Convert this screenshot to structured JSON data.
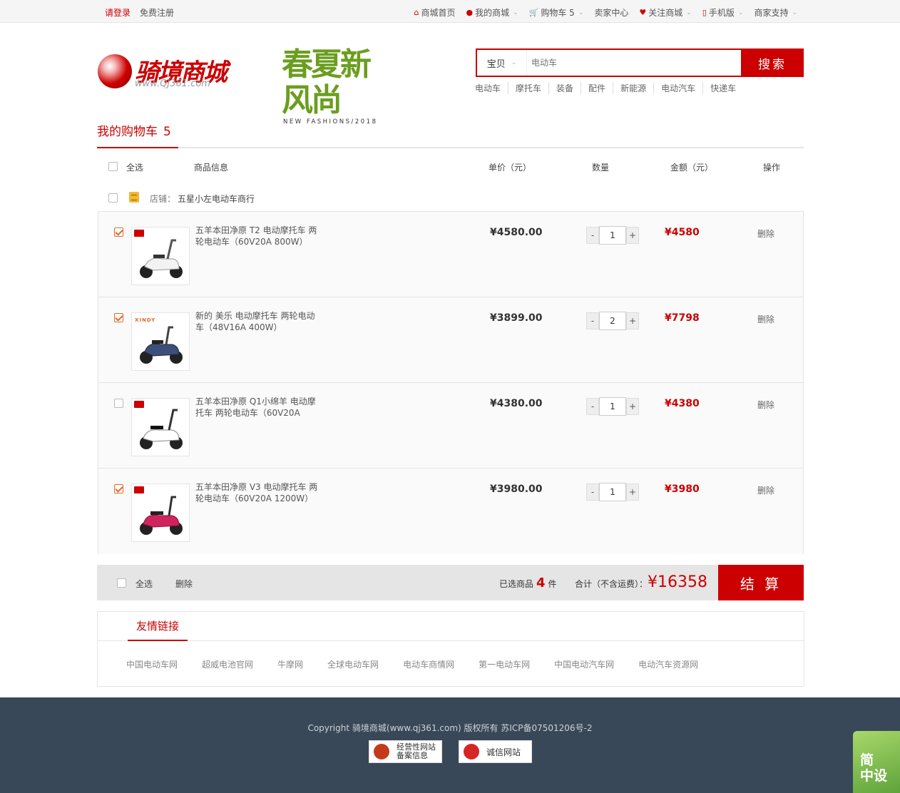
{
  "topbar": {
    "login": "请登录",
    "register": "免费注册",
    "home": "商城首页",
    "my_mall": "我的商城",
    "cart": "购物车 5",
    "seller": "卖家中心",
    "follow": "关注商城",
    "mobile": "手机版",
    "support": "商家支持"
  },
  "logo": {
    "text": "骑境商城",
    "url": "www.QJ361.com"
  },
  "banner": {
    "cn": "春夏新风尚",
    "en": "NEW FASHIONS/2018"
  },
  "search": {
    "category": "宝贝",
    "placeholder": "电动车",
    "button": "搜索",
    "hotwords": [
      "电动车",
      "摩托车",
      "装备",
      "配件",
      "新能源",
      "电动汽车",
      "快递车"
    ]
  },
  "cart": {
    "title": "我的购物车",
    "count": "5",
    "headers": {
      "select_all": "全选",
      "info": "商品信息",
      "price": "单价（元）",
      "qty": "数量",
      "amount": "金额（元）",
      "op": "操作"
    },
    "shop_label": "店铺：",
    "shop_name": "五星小左电动车商行",
    "items": [
      {
        "name": "五羊本田净原 T2 电动摩托车 两轮电动车（60V20A 800W）",
        "price": "¥4580.00",
        "qty": "1",
        "amount": "¥4580",
        "delete": "删除",
        "checked": true
      },
      {
        "name": "新的 美乐 电动摩托车 两轮电动车（48V16A 400W）",
        "price": "¥3899.00",
        "qty": "2",
        "amount": "¥7798",
        "delete": "删除",
        "checked": true
      },
      {
        "name": "五羊本田净原 Q1小绵羊 电动摩托车 两轮电动车（60V20A",
        "price": "¥4380.00",
        "qty": "1",
        "amount": "¥4380",
        "delete": "删除",
        "checked": false
      },
      {
        "name": "五羊本田净原 V3 电动摩托车 两轮电动车（60V20A 1200W）",
        "price": "¥3980.00",
        "qty": "1",
        "amount": "¥3980",
        "delete": "删除",
        "checked": true
      }
    ],
    "qty_minus": "-",
    "qty_plus": "+",
    "xindy_badge": "XINDY"
  },
  "summary": {
    "select_all": "全选",
    "delete": "删除",
    "selected_prefix": "已选商品",
    "selected_count": "4",
    "selected_suffix": "件",
    "total_label": "合计（不含运费）：",
    "total": "¥16358",
    "checkout": "结 算"
  },
  "links": {
    "title": "友情链接",
    "items": [
      "中国电动车网",
      "超威电池官网",
      "牛摩网",
      "全球电动车网",
      "电动车商情网",
      "第一电动车网",
      "中国电动汽车网",
      "电动汽车资源网"
    ]
  },
  "footer": {
    "copyright": "Copyright 骑境商城(www.qj361.com) 版权所有 苏ICP备07501206号-2",
    "cert1_line1": "经营性网站",
    "cert1_line2": "备案信息",
    "cert2": "诚信网站"
  },
  "widget": {
    "line1": "简",
    "line2": "中设"
  },
  "colors": {
    "accent": "#cc0000",
    "footer_bg": "#384859",
    "checkbox": "#e06a2b"
  }
}
